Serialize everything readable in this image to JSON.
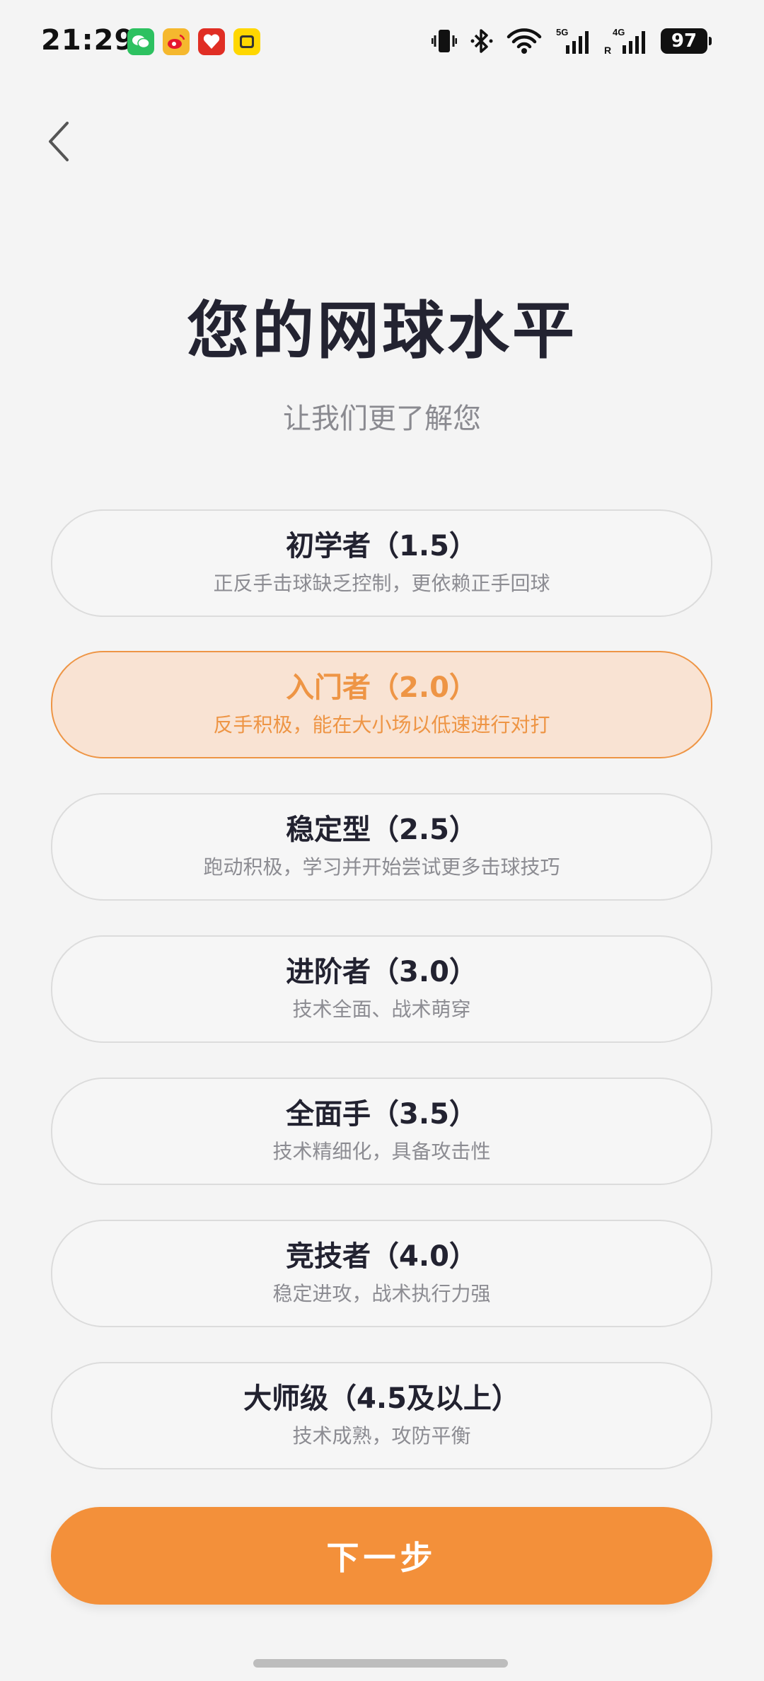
{
  "status_bar": {
    "time": "21:29",
    "battery": "97",
    "notif_icons": [
      {
        "name": "wechat-icon",
        "color": "#2dc160"
      },
      {
        "name": "weibo-icon",
        "color": "#f5b82e"
      },
      {
        "name": "pinduoduo-icon",
        "color": "#e02e24"
      },
      {
        "name": "xianyu-icon",
        "color": "#ffd700"
      }
    ],
    "network_labels": {
      "g5": "5G",
      "g4": "4G",
      "roaming": "R"
    }
  },
  "header": {
    "title": "您的网球水平",
    "subtitle": "让我们更了解您"
  },
  "levels": [
    {
      "title": "初学者（1.5）",
      "desc": "正反手击球缺乏控制，更依赖正手回球",
      "selected": false
    },
    {
      "title": "入门者（2.0）",
      "desc": "反手积极，能在大小场以低速进行对打",
      "selected": true
    },
    {
      "title": "稳定型（2.5）",
      "desc": "跑动积极，学习并开始尝试更多击球技巧",
      "selected": false
    },
    {
      "title": "进阶者（3.0）",
      "desc": "技术全面、战术萌穿",
      "selected": false
    },
    {
      "title": "全面手（3.5）",
      "desc": "技术精细化，具备攻击性",
      "selected": false
    },
    {
      "title": "竞技者（4.0）",
      "desc": "稳定进攻，战术执行力强",
      "selected": false
    },
    {
      "title": "大师级（4.5及以上）",
      "desc": "技术成熟，攻防平衡",
      "selected": false
    }
  ],
  "next_button": {
    "label": "下一步"
  },
  "colors": {
    "accent": "#f3903a",
    "selected_bg": "#f9e3d3",
    "selected_border": "#ee9545"
  }
}
